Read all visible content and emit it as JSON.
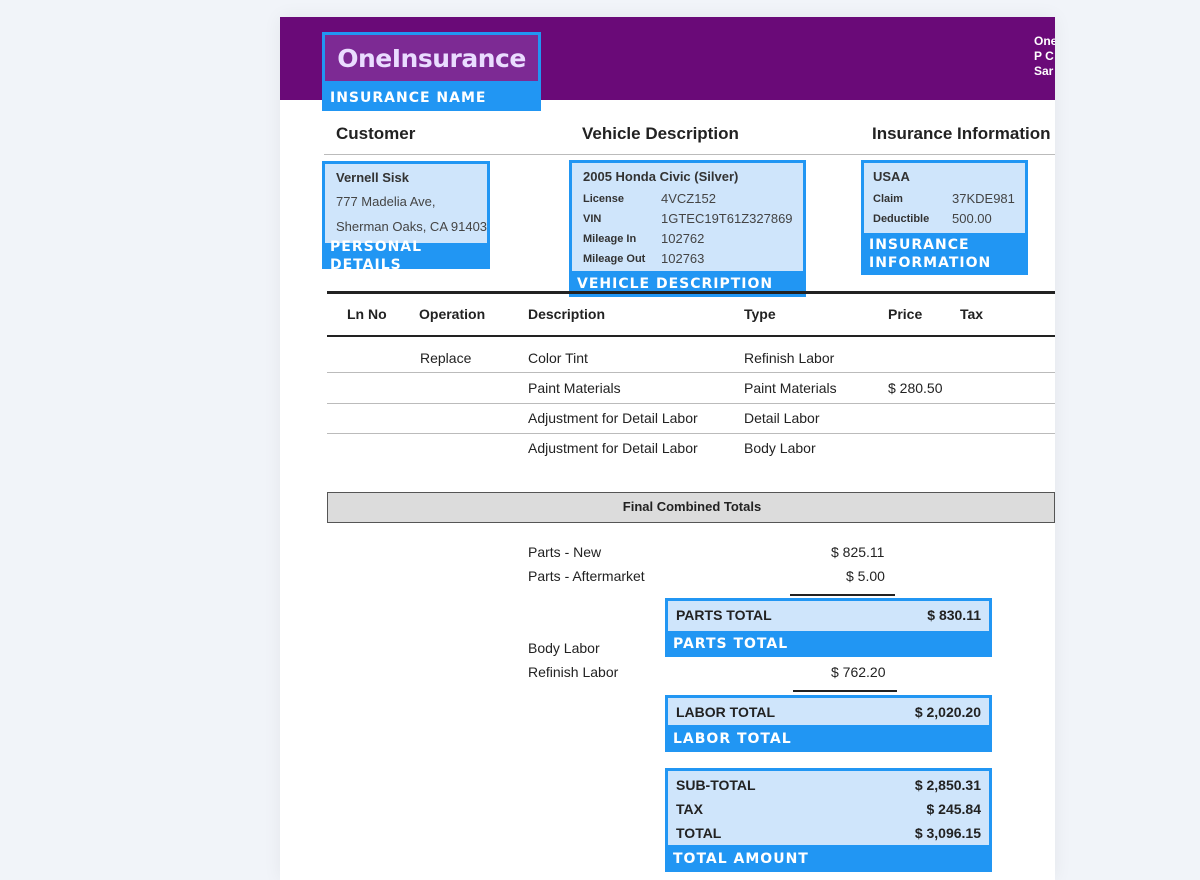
{
  "brand": {
    "logo": "OneInsurance",
    "tag": "INSURANCE NAME",
    "address": [
      "One",
      "P C",
      "Sar"
    ],
    "header_color": "#6a0a78",
    "highlight_color": "#2196f3"
  },
  "sections": {
    "customer": "Customer",
    "vehicle": "Vehicle Description",
    "insurance": "Insurance Information"
  },
  "customer": {
    "name": "Vernell Sisk",
    "address1": "777 Madelia Ave,",
    "address2": "Sherman Oaks, CA 91403",
    "tag": "PERSONAL DETAILS"
  },
  "vehicle": {
    "title": "2005 Honda Civic (Silver)",
    "rows": [
      {
        "label": "License",
        "value": "4VCZ152"
      },
      {
        "label": "VIN",
        "value": "1GTEC19T61Z327869"
      },
      {
        "label": "Mileage In",
        "value": "102762"
      },
      {
        "label": "Mileage Out",
        "value": "102763"
      }
    ],
    "tag": "VEHICLE DESCRIPTION"
  },
  "insurance": {
    "company": "USAA",
    "rows": [
      {
        "label": "Claim",
        "value": "37KDE981"
      },
      {
        "label": "Deductible",
        "value": "500.00"
      }
    ],
    "tag_line1": "INSURANCE",
    "tag_line2": "INFORMATION"
  },
  "table": {
    "headers": [
      "Ln No",
      "Operation",
      "Description",
      "Type",
      "Price",
      "Tax"
    ],
    "rows": [
      {
        "ln": "",
        "op": "Replace",
        "desc": "Color Tint",
        "type": "Refinish Labor",
        "price": "",
        "tax": ""
      },
      {
        "ln": "",
        "op": "",
        "desc": "Paint Materials",
        "type": "Paint Materials",
        "price": "$ 280.50",
        "tax": ""
      },
      {
        "ln": "",
        "op": "",
        "desc": "Adjustment for Detail Labor",
        "type": "Detail Labor",
        "price": "",
        "tax": ""
      },
      {
        "ln": "",
        "op": "",
        "desc": "Adjustment for Detail Labor",
        "type": "Body Labor",
        "price": "",
        "tax": ""
      }
    ]
  },
  "totals": {
    "band_title": "Final Combined Totals",
    "parts_new_label": "Parts - New",
    "parts_new_value": "$ 825.11",
    "parts_after_label": "Parts - Aftermarket",
    "parts_after_value": "$ 5.00",
    "parts_total_label": "PARTS TOTAL",
    "parts_total_value": "$ 830.11",
    "parts_total_tag": "PARTS TOTAL",
    "body_labor_label": "Body Labor",
    "refinish_labor_label": "Refinish Labor",
    "refinish_labor_value": "$ 762.20",
    "labor_total_label": "LABOR TOTAL",
    "labor_total_value": "$ 2,020.20",
    "labor_total_tag": "LABOR TOTAL",
    "subtotal_label": "SUB-TOTAL",
    "subtotal_value": "$ 2,850.31",
    "tax_label": "TAX",
    "tax_value": "$ 245.84",
    "total_label": "TOTAL",
    "total_value": "$ 3,096.15",
    "total_tag": "TOTAL AMOUNT"
  }
}
